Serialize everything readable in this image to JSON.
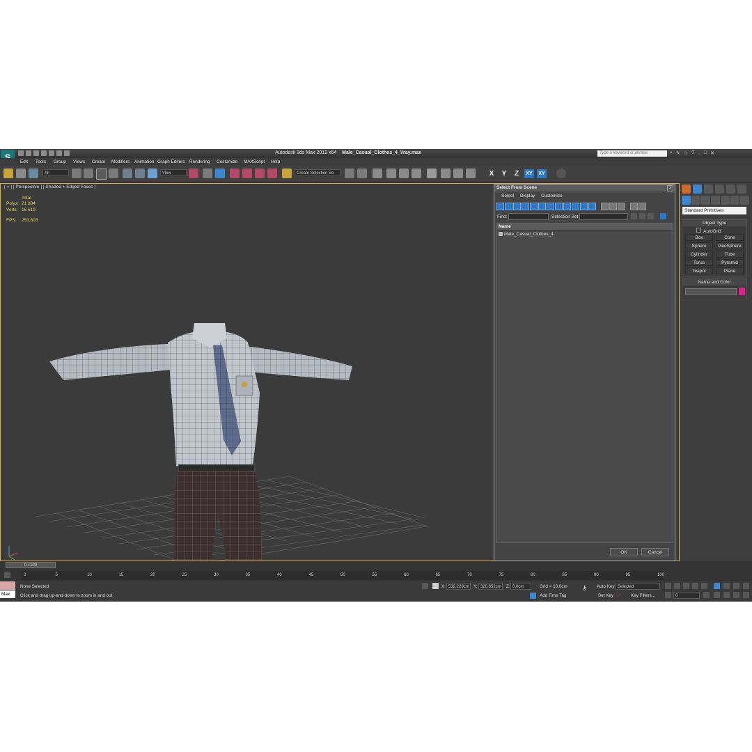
{
  "app": {
    "logo": "3ds-max-logo",
    "title_app": "Autodesk 3ds Max  2012 x64",
    "title_file": "Male_Casual_Clothes_4_Vray.max",
    "search_placeholder": "Type a keyword or phrase"
  },
  "menu": [
    "Edit",
    "Tools",
    "Group",
    "Views",
    "Create",
    "Modifiers",
    "Animation",
    "Graph Editors",
    "Rendering",
    "Customize",
    "MAXScript",
    "Help"
  ],
  "toolbar": {
    "selection_filter": "All",
    "reference_coord": "View",
    "selection_set": "Create Selection Se",
    "axis": [
      "X",
      "Y",
      "Z",
      "XY",
      "XY"
    ]
  },
  "viewport": {
    "label": "[ + ] [ Perspective ] [ Shaded + Edged Faces ]",
    "stats": {
      "header": "Total",
      "polys_label": "Polys:",
      "polys_value": "21 884",
      "verts_label": "Verts:",
      "verts_value": "16 619",
      "fps_label": "FPS:",
      "fps_value": "253,603"
    }
  },
  "dialog": {
    "title": "Select From Scene",
    "close": "x",
    "menu": [
      "Select",
      "Display",
      "Customize"
    ],
    "find_label": "Find:",
    "selection_set_label": "Selection Set:",
    "column_name": "Name",
    "items": [
      "Male_Casual_Clothes_4"
    ],
    "ok": "OK",
    "cancel": "Cancel"
  },
  "command_panel": {
    "category": "Standard Primitives",
    "object_type_title": "Object Type",
    "autogrid": "AutoGrid",
    "primitives": [
      "Box",
      "Cone",
      "Sphere",
      "GeoSphere",
      "Cylinder",
      "Tube",
      "Torus",
      "Pyramid",
      "Teapot",
      "Plane"
    ],
    "name_color_title": "Name and Color",
    "color": "#e0208c"
  },
  "timeline": {
    "frame_display": "0 / 100",
    "ticks": [
      "0",
      "5",
      "10",
      "15",
      "20",
      "25",
      "30",
      "35",
      "40",
      "45",
      "50",
      "55",
      "60",
      "65",
      "70",
      "75",
      "80",
      "85",
      "90",
      "95",
      "100"
    ]
  },
  "status": {
    "maxscript": "Max",
    "selection": "None Selected",
    "prompt": "Click and drag up-and-down to zoom in and out",
    "x_label": "X:",
    "x_value": "532,229cm",
    "y_label": "Y:",
    "y_value": "320,852cm",
    "z_label": "Z:",
    "z_value": "0,0cm",
    "grid": "Grid = 10,0cm",
    "add_time_tag": "Add Time Tag",
    "auto_key": "Auto Key",
    "auto_key_mode": "Selected",
    "set_key": "Set Key",
    "key_filters": "Key Filters...",
    "frame": "0"
  }
}
